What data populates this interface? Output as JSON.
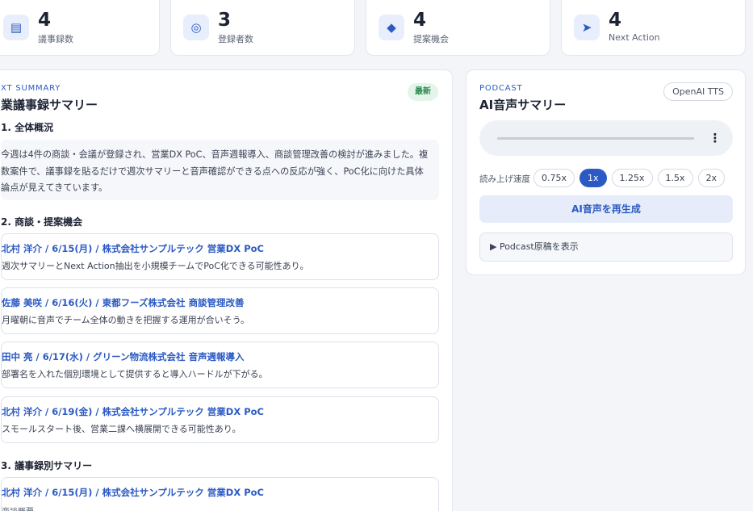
{
  "stats": [
    {
      "icon": "list-icon",
      "glyph": "▤",
      "value": "4",
      "label": "議事録数"
    },
    {
      "icon": "user-circle-icon",
      "glyph": "◎",
      "value": "3",
      "label": "登録者数"
    },
    {
      "icon": "diamond-icon",
      "glyph": "◆",
      "value": "4",
      "label": "提案機会"
    },
    {
      "icon": "arrow-icon",
      "glyph": "➤",
      "value": "4",
      "label": "Next Action"
    }
  ],
  "summary": {
    "eyebrow": "XT SUMMARY",
    "title": "業議事録サマリー",
    "badge": "最新",
    "section1": "1. 全体概況",
    "overview": "今週は4件の商談・会議が登録され、営業DX PoC、音声週報導入、商談管理改善の検討が進みました。複数案件で、議事録を貼るだけで週次サマリーと音声確認ができる点への反応が強く、PoC化に向けた具体論点が見えてきています。",
    "section2": "2. 商談・提案機会",
    "opportunities": [
      {
        "title": "北村 洋介 / 6/15(月) / 株式会社サンプルテック 営業DX PoC",
        "desc": "週次サマリーとNext Action抽出を小規模チームでPoC化できる可能性あり。"
      },
      {
        "title": "佐藤 美咲 / 6/16(火) / 東都フーズ株式会社 商談管理改善",
        "desc": "月曜朝に音声でチーム全体の動きを把握する運用が合いそう。"
      },
      {
        "title": "田中 亮 / 6/17(水) / グリーン物流株式会社 音声週報導入",
        "desc": "部署名を入れた個別環境として提供すると導入ハードルが下がる。"
      },
      {
        "title": "北村 洋介 / 6/19(金) / 株式会社サンプルテック 営業DX PoC",
        "desc": "スモールスタート後、営業二課へ横展開できる可能性あり。"
      }
    ],
    "section3": "3. 議事録別サマリー",
    "minutes": [
      {
        "title": "北村 洋介 / 6/15(月) / 株式会社サンプルテック 営業DX PoC",
        "sub": "商談概要"
      }
    ]
  },
  "podcast": {
    "eyebrow": "PODCAST",
    "title": "AI音声サマリー",
    "badge": "OpenAI TTS",
    "speed_label": "読み上げ速度",
    "speeds": [
      "0.75x",
      "1x",
      "1.25x",
      "1.5x",
      "2x"
    ],
    "active_speed": "1x",
    "regenerate": "AI音声を再生成",
    "script_toggle": "▶ Podcast原稿を表示"
  },
  "colors": {
    "accent": "#2b5ac4",
    "badge_green": "#2e8b4f",
    "background": "#f3f5f9"
  }
}
